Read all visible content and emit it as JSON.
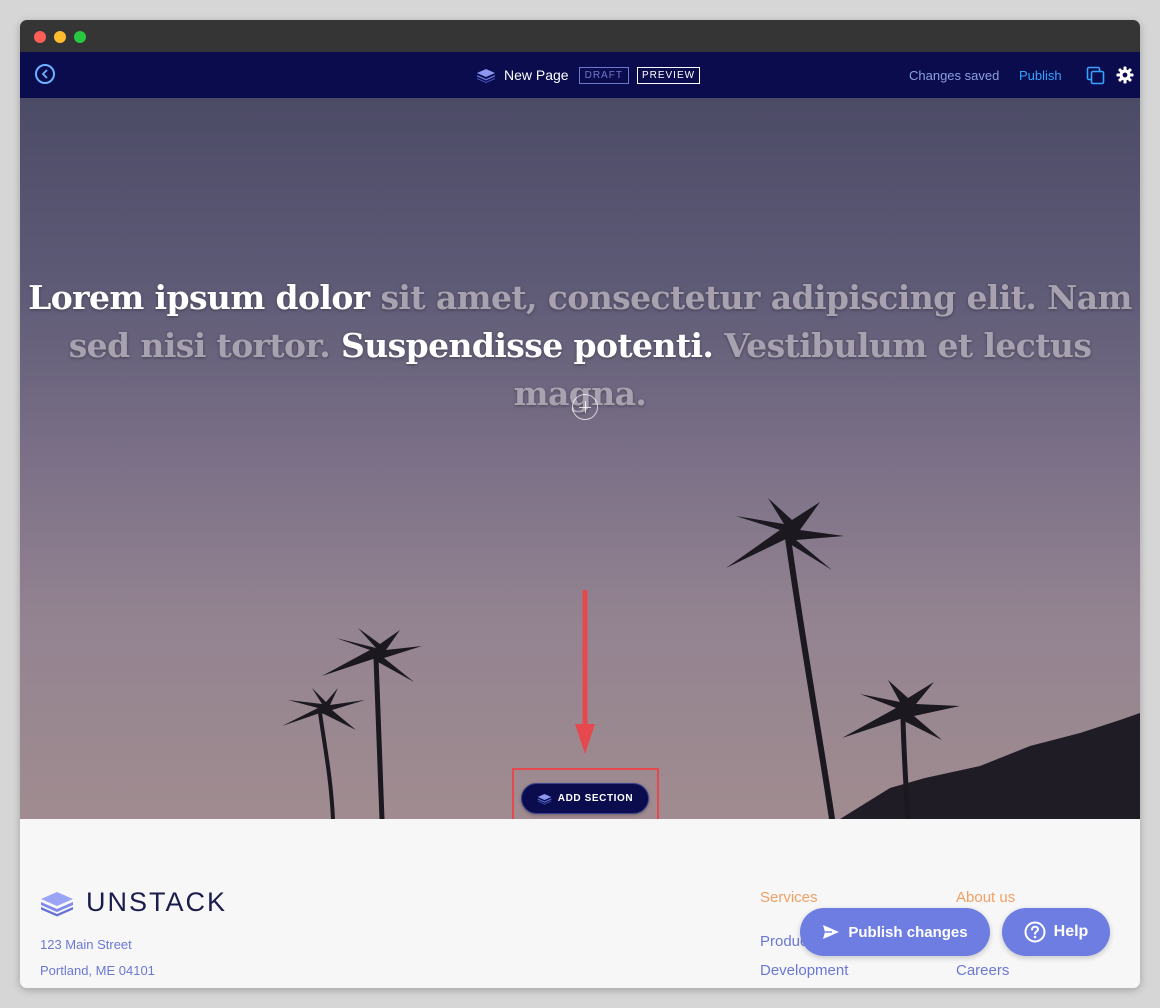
{
  "editor": {
    "page_title": "New Page",
    "draft_badge": "DRAFT",
    "preview_badge": "PREVIEW",
    "save_status": "Changes saved",
    "publish_link": "Publish"
  },
  "hero": {
    "headline": [
      {
        "text": "Lorem ipsum dolor ",
        "style": "bold"
      },
      {
        "text": "sit amet, consectetur adipiscing elit. Nam sed nisi tortor. ",
        "style": "muted"
      },
      {
        "text": "Suspendisse potenti. ",
        "style": "bold"
      },
      {
        "text": "Vestibulum et lectus magna.",
        "style": "muted"
      }
    ],
    "add_section_label": "ADD SECTION"
  },
  "footer": {
    "brand": "UNSTACK",
    "address_line1": "123 Main Street",
    "address_line2": "Portland, ME 04101",
    "services_heading": "Services",
    "about_heading": "About us",
    "services_links": [
      "Product",
      "Development"
    ],
    "about_links": [
      "",
      "Careers"
    ]
  },
  "floating": {
    "publish_changes": "Publish changes",
    "help": "Help"
  },
  "colors": {
    "nav_bg": "#0b0c4e",
    "accent_blue": "#36a3ff",
    "button_purple": "#6e7de1",
    "footer_heading": "#f0a063",
    "footer_link": "#6b78d3",
    "highlight_red": "#e5484d"
  },
  "icons": [
    "back-arrow-icon",
    "layers-icon",
    "copy-icon",
    "gear-icon",
    "plus-icon",
    "send-icon",
    "question-icon"
  ]
}
